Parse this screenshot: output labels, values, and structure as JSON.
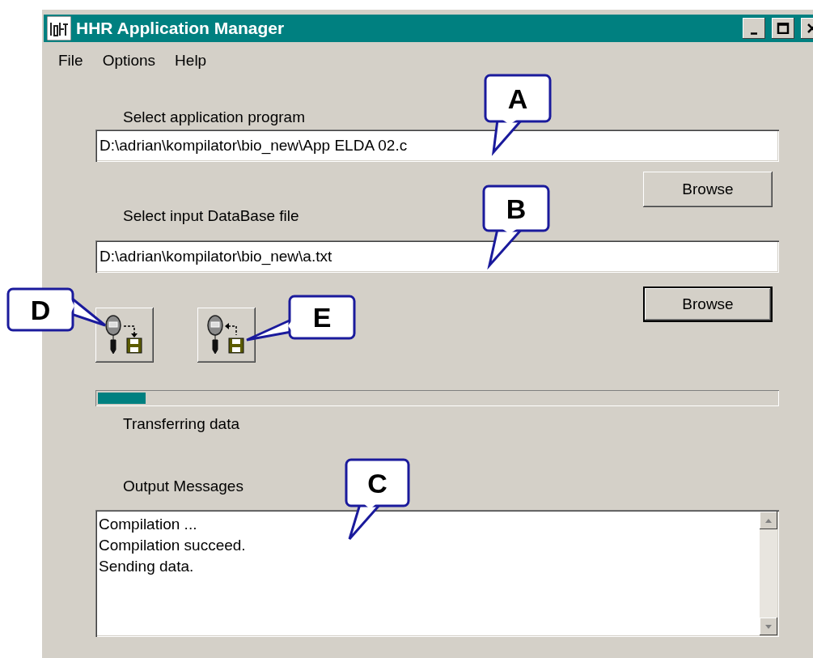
{
  "window": {
    "title": "HHR Application Manager"
  },
  "menu": [
    "File",
    "Options",
    "Help"
  ],
  "program": {
    "label": "Select application program",
    "value": "D:\\adrian\\kompilator\\bio_new\\App ELDA 02.c",
    "button": "Browse",
    "default": false
  },
  "database": {
    "label": "Select input DataBase file",
    "value": "D:\\adrian\\kompilator\\bio_new\\a.txt",
    "button": "Browse",
    "default": true
  },
  "transfer_buttons": [
    {
      "kind": "receive"
    },
    {
      "kind": "send"
    }
  ],
  "progress": {
    "level": 0.07,
    "label": "Transferring data"
  },
  "output": {
    "label": "Output Messages",
    "lines": [
      "Compilation ...",
      "Compilation succeed.",
      "Sending data."
    ]
  },
  "callouts": [
    {
      "letter": "A"
    },
    {
      "letter": "B"
    },
    {
      "letter": "C"
    },
    {
      "letter": "D"
    },
    {
      "letter": "E"
    }
  ]
}
